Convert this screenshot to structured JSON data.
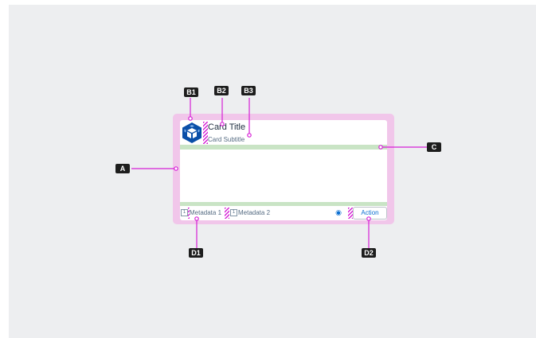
{
  "card": {
    "title": "Card Title",
    "subtitle": "Card Subtitle",
    "metadata": [
      {
        "icon": "1",
        "label": "Metadata 1"
      },
      {
        "icon": "1",
        "label": "Metadata 2"
      }
    ],
    "action_icon": "eye-icon",
    "action_label": "Action"
  },
  "callouts": {
    "a": "A",
    "b1": "B1",
    "b2": "B2",
    "b3": "B3",
    "c": "C",
    "d1": "D1",
    "d2": "D2"
  },
  "colors": {
    "background": "#edeef0",
    "card_outline": "#f1c6ea",
    "annotation_magenta": "#d61fd6",
    "divider_green": "#c9e4c5",
    "avatar_blue": "#0a4fa8",
    "action_blue": "#0a6ed1"
  }
}
